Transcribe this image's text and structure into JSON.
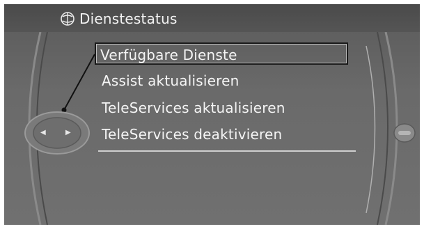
{
  "header": {
    "title": "Dienstestatus",
    "icon": "bmw-services-icon"
  },
  "menu": {
    "items": [
      {
        "label": "Verfügbare Dienste",
        "selected": true
      },
      {
        "label": "Assist aktualisieren",
        "selected": false
      },
      {
        "label": "TeleServices aktualisieren",
        "selected": false
      },
      {
        "label": "TeleServices deaktivieren",
        "selected": false
      }
    ]
  },
  "controller": {
    "left_icon": "arrow-left-icon",
    "right_icon": "arrow-right-icon",
    "left_glyph": "◀",
    "right_glyph": "▶"
  },
  "colors": {
    "screen_bg": "#6a6a6a",
    "header_bg": "#505050",
    "text": "#f4f4f4",
    "selection_border": "#1a1a1a"
  }
}
